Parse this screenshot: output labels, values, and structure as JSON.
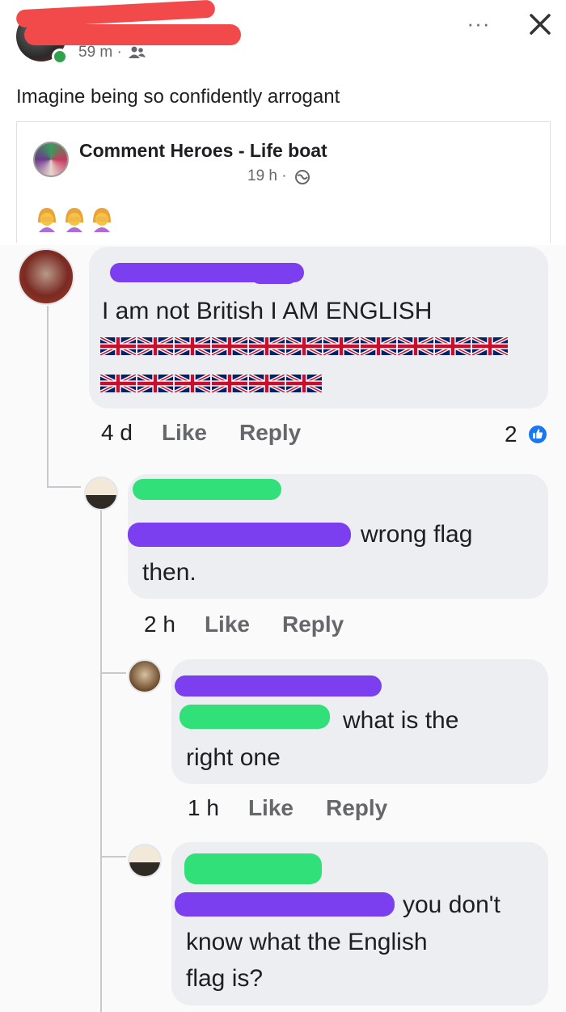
{
  "post": {
    "time": "59 m ·",
    "more_label": "···",
    "text": "Imagine being so confidently arrogant"
  },
  "shared": {
    "group_name": "Comment Heroes - Life boat",
    "time": "19 h ·"
  },
  "comments": [
    {
      "text": "I am not British I AM ENGLISH",
      "time": "4 d",
      "like": "Like",
      "reply": "Reply",
      "reaction_count": "2",
      "flags_row1": 11,
      "flags_row2": 6
    },
    {
      "text_tail": "wrong flag",
      "text_line2": "then.",
      "time": "2 h",
      "like": "Like",
      "reply": "Reply"
    },
    {
      "text_tail": "what is the",
      "text_line2": "right one",
      "time": "1 h",
      "like": "Like",
      "reply": "Reply"
    },
    {
      "text_tail": "you don't",
      "text_line2": "know what the English",
      "text_line3": "flag is?"
    }
  ],
  "colors": {
    "redact_red": "#f24a4a",
    "redact_purple": "#7b3ff0",
    "redact_green": "#32e07a",
    "like_blue": "#1877f2"
  }
}
